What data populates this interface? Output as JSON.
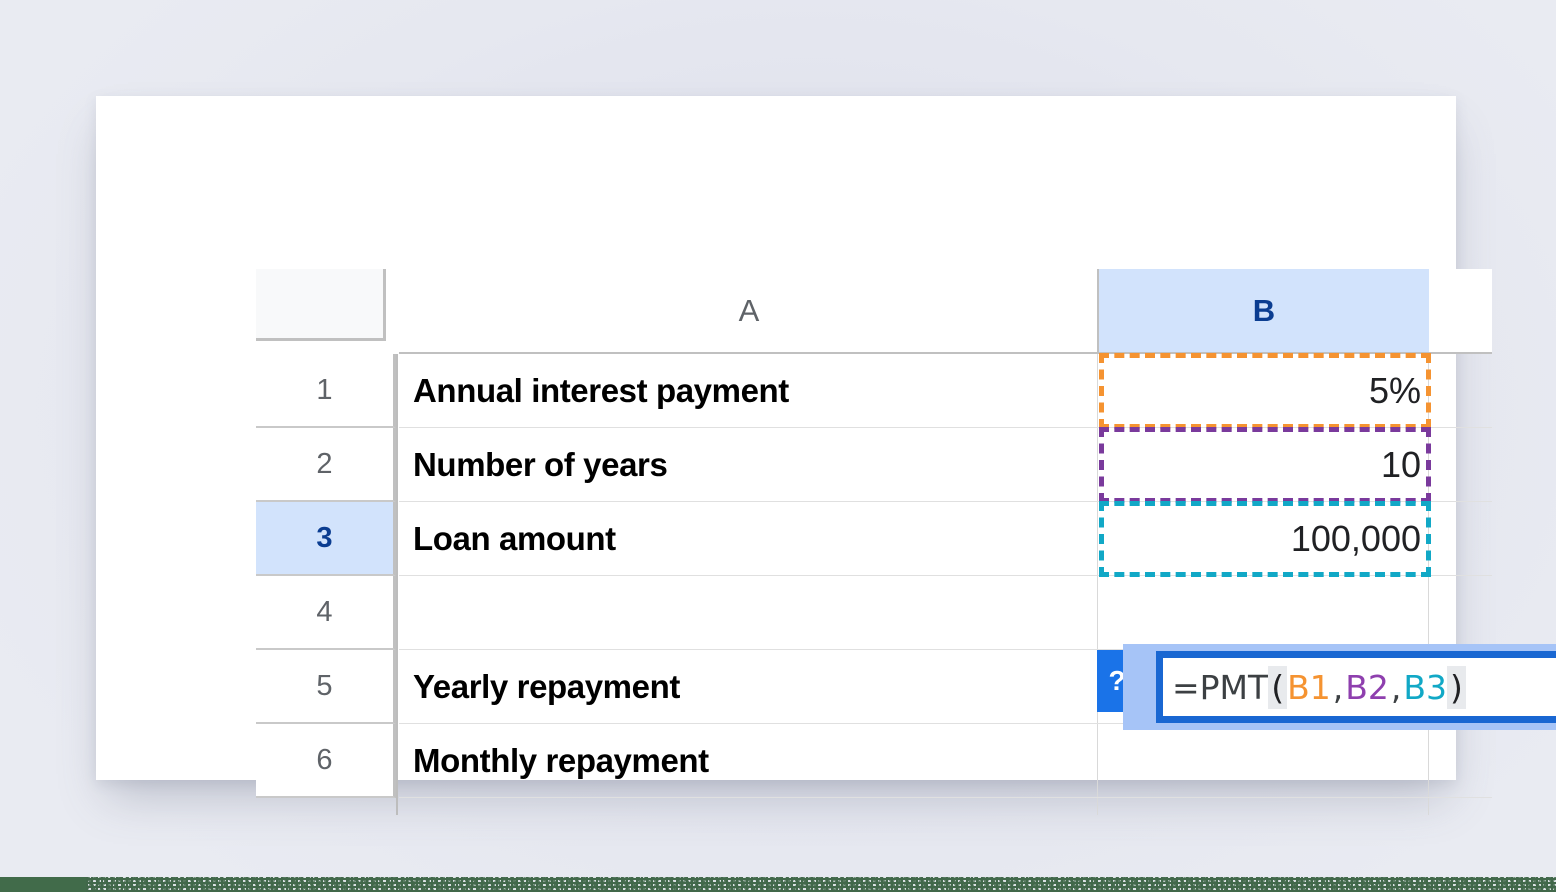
{
  "spreadsheet": {
    "columns": [
      {
        "id": "A",
        "label": "A",
        "selected": false
      },
      {
        "id": "B",
        "label": "B",
        "selected": true
      },
      {
        "id": "C",
        "label": "",
        "selected": false
      }
    ],
    "rows": [
      {
        "num": "1",
        "selected": false,
        "a": "Annual interest payment",
        "b": "5%"
      },
      {
        "num": "2",
        "selected": false,
        "a": "Number of years",
        "b": "10"
      },
      {
        "num": "3",
        "selected": true,
        "a": "Loan amount",
        "b": "100,000"
      },
      {
        "num": "4",
        "selected": false,
        "a": "",
        "b": ""
      },
      {
        "num": "5",
        "selected": false,
        "a": "Yearly repayment",
        "b": ""
      },
      {
        "num": "6",
        "selected": false,
        "a": "Monthly repayment",
        "b": ""
      }
    ],
    "reference_outlines": [
      {
        "cell": "B1",
        "color": "#f59331"
      },
      {
        "cell": "B2",
        "color": "#7a3a9c"
      },
      {
        "cell": "B3",
        "color": "#11a8c6"
      }
    ],
    "active_cell": "B5",
    "formula": {
      "full_text": "=PMT(B1,B2,B3)",
      "function_name": "PMT",
      "prefix": "=PMT",
      "open_paren": "(",
      "close_paren": ")",
      "comma": ",",
      "args": [
        {
          "text": "B1",
          "color": "#f59331"
        },
        {
          "text": "B2",
          "color": "#8e3fae"
        },
        {
          "text": "B3",
          "color": "#11a8c6"
        }
      ],
      "help_badge_label": "?"
    },
    "colors": {
      "selection_blue": "#1967d2",
      "selection_halo": "#a6c4f7",
      "header_highlight": "#d2e3fc",
      "badge_blue": "#1a73e8",
      "page_background": "#e5e7ef",
      "bottom_strip_green": "#416b4a"
    }
  }
}
